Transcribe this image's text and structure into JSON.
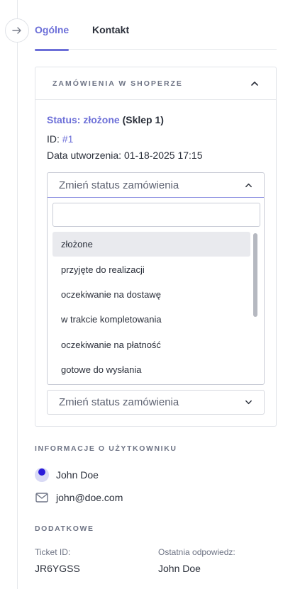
{
  "tabs": [
    {
      "label": "Ogólne",
      "active": true
    },
    {
      "label": "Kontakt",
      "active": false
    }
  ],
  "orders_card": {
    "title": "ZAMÓWIENIA W SHOPERZE",
    "status_prefix": "Status: złożone",
    "store": "(Sklep 1)",
    "id_label": "ID:",
    "id_value": "#1",
    "date_label": "Data utworzenia:",
    "date_value": "01-18-2025 17:15",
    "status_select": {
      "placeholder": "Zmień status zamówienia",
      "search_value": "",
      "options": [
        {
          "label": "złożone",
          "selected": true
        },
        {
          "label": "przyjęte do realizacji",
          "selected": false
        },
        {
          "label": "oczekiwanie na dostawę",
          "selected": false
        },
        {
          "label": "w trakcie kompletowania",
          "selected": false
        },
        {
          "label": "oczekiwanie na płatność",
          "selected": false
        },
        {
          "label": "gotowe do wysłania",
          "selected": false
        }
      ]
    },
    "second_select": {
      "placeholder": "Zmień status zamówienia"
    }
  },
  "user_info": {
    "title": "INFORMACJE O UŻYTKOWNIKU",
    "name": "John Doe",
    "email": "john@doe.com"
  },
  "additional": {
    "title": "DODATKOWE",
    "ticket_label": "Ticket ID:",
    "ticket_value": "JR6YGSS",
    "last_reply_label": "Ostatnia odpowiedz:",
    "last_reply_value": "John Doe"
  },
  "colors": {
    "accent": "#6c6fd8",
    "avatar_dot": "#2a1bd9"
  },
  "icons": [
    "arrow-right-icon",
    "chevron-up-icon",
    "chevron-down-icon",
    "mail-icon"
  ]
}
